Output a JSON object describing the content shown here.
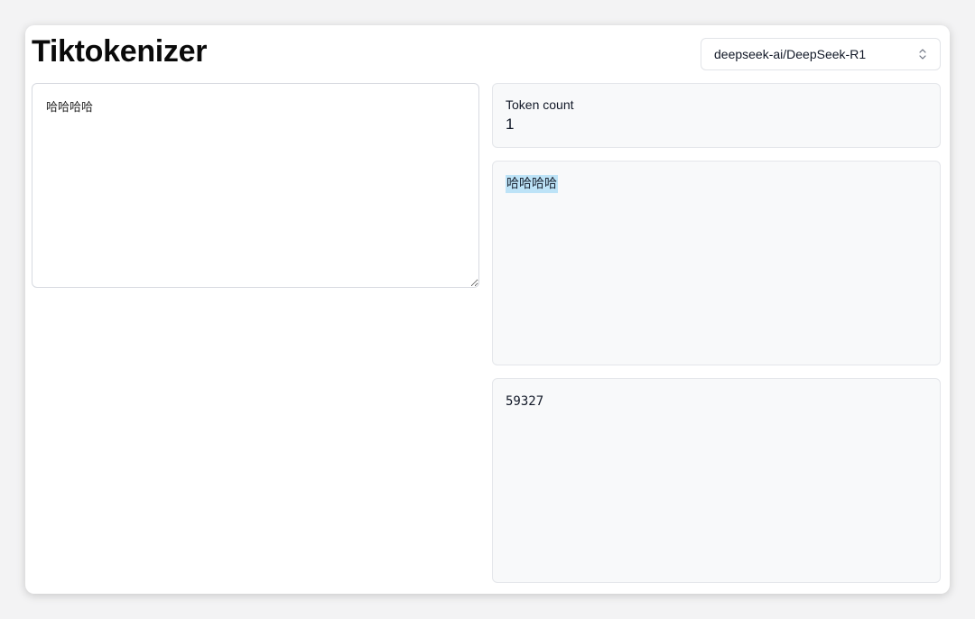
{
  "app": {
    "title": "Tiktokenizer"
  },
  "model_select": {
    "value": "deepseek-ai/DeepSeek-R1"
  },
  "input": {
    "value": "哈哈哈哈"
  },
  "token_count": {
    "label": "Token count",
    "value": "1"
  },
  "tokens": [
    {
      "text": "哈哈哈哈",
      "highlight_color": "#bde3f7"
    }
  ],
  "token_ids": {
    "text": "59327"
  },
  "icons": {
    "model_select": "chevron-up-down-icon"
  }
}
